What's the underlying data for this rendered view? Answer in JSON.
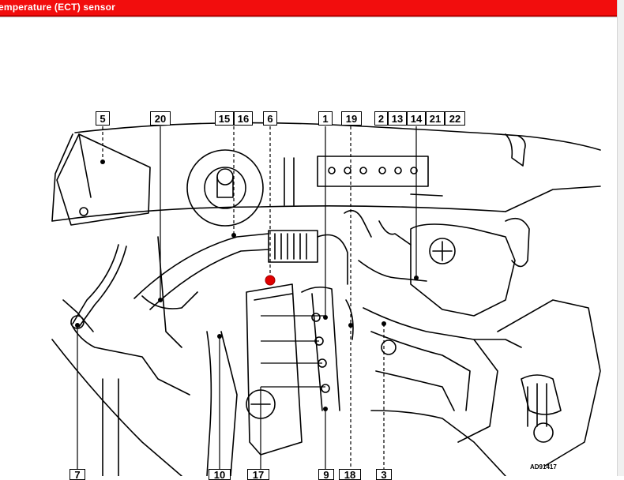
{
  "header": {
    "title": "emperature (ECT) sensor",
    "bar_color": "#f20d0d"
  },
  "callouts_top": [
    "5",
    "20",
    "15",
    "16",
    "6",
    "1",
    "19",
    "2",
    "13",
    "14",
    "21",
    "22"
  ],
  "callouts_bottom": [
    "7",
    "10",
    "17",
    "9",
    "18",
    "3"
  ],
  "reference_code": "AD91417",
  "highlight_color": "#e00000"
}
